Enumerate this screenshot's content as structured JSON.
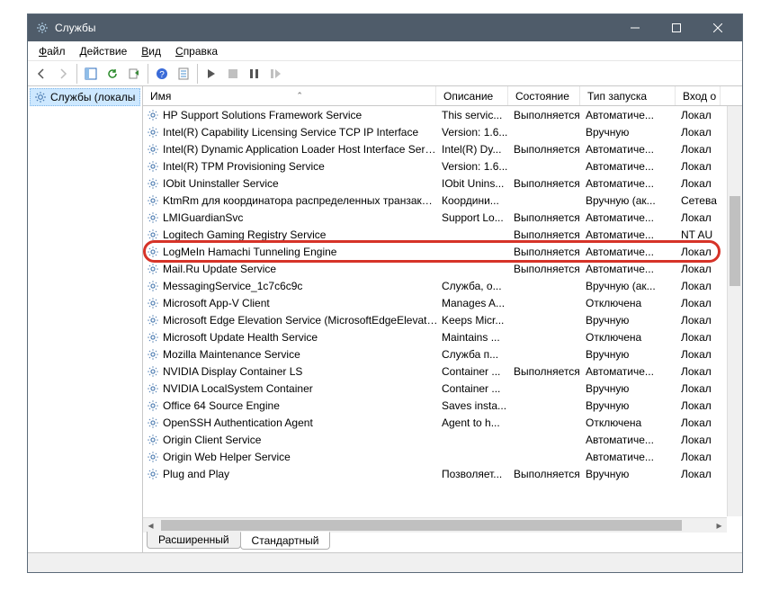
{
  "window": {
    "title": "Службы"
  },
  "menu": {
    "file": "Файл",
    "action": "Действие",
    "view": "Вид",
    "help": "Справка"
  },
  "left_pane": {
    "item": "Службы (локалы"
  },
  "columns": {
    "name": "Имя",
    "description": "Описание",
    "status": "Состояние",
    "startup": "Тип запуска",
    "logon": "Вход о"
  },
  "tabs": {
    "extended": "Расширенный",
    "standard": "Стандартный"
  },
  "services": [
    {
      "name": "HP Support Solutions Framework Service",
      "desc": "This servic...",
      "status": "Выполняется",
      "startup": "Автоматиче...",
      "logon": "Локал"
    },
    {
      "name": "Intel(R) Capability Licensing Service TCP IP Interface",
      "desc": "Version: 1.6...",
      "status": "",
      "startup": "Вручную",
      "logon": "Локал"
    },
    {
      "name": "Intel(R) Dynamic Application Loader Host Interface Service",
      "desc": "Intel(R) Dy...",
      "status": "Выполняется",
      "startup": "Автоматиче...",
      "logon": "Локал"
    },
    {
      "name": "Intel(R) TPM Provisioning Service",
      "desc": "Version: 1.6...",
      "status": "",
      "startup": "Автоматиче...",
      "logon": "Локал"
    },
    {
      "name": "IObit Uninstaller Service",
      "desc": "IObit Unins...",
      "status": "Выполняется",
      "startup": "Автоматиче...",
      "logon": "Локал"
    },
    {
      "name": "KtmRm для координатора распределенных транзакций",
      "desc": "Координи...",
      "status": "",
      "startup": "Вручную (ак...",
      "logon": "Сетева"
    },
    {
      "name": "LMIGuardianSvc",
      "desc": "Support Lo...",
      "status": "Выполняется",
      "startup": "Автоматиче...",
      "logon": "Локал"
    },
    {
      "name": "Logitech Gaming Registry Service",
      "desc": "",
      "status": "Выполняется",
      "startup": "Автоматиче...",
      "logon": "NT AU"
    },
    {
      "name": "LogMeIn Hamachi Tunneling Engine",
      "desc": "",
      "status": "Выполняется",
      "startup": "Автоматиче...",
      "logon": "Локал",
      "highlight": true
    },
    {
      "name": "Mail.Ru Update Service",
      "desc": "",
      "status": "Выполняется",
      "startup": "Автоматиче...",
      "logon": "Локал"
    },
    {
      "name": "MessagingService_1c7c6c9c",
      "desc": "Служба, о...",
      "status": "",
      "startup": "Вручную (ак...",
      "logon": "Локал"
    },
    {
      "name": "Microsoft App-V Client",
      "desc": "Manages A...",
      "status": "",
      "startup": "Отключена",
      "logon": "Локал"
    },
    {
      "name": "Microsoft Edge Elevation Service (MicrosoftEdgeElevatio...",
      "desc": "Keeps Micr...",
      "status": "",
      "startup": "Вручную",
      "logon": "Локал"
    },
    {
      "name": "Microsoft Update Health Service",
      "desc": "Maintains ...",
      "status": "",
      "startup": "Отключена",
      "logon": "Локал"
    },
    {
      "name": "Mozilla Maintenance Service",
      "desc": "Служба п...",
      "status": "",
      "startup": "Вручную",
      "logon": "Локал"
    },
    {
      "name": "NVIDIA Display Container LS",
      "desc": "Container ...",
      "status": "Выполняется",
      "startup": "Автоматиче...",
      "logon": "Локал"
    },
    {
      "name": "NVIDIA LocalSystem Container",
      "desc": "Container ...",
      "status": "",
      "startup": "Вручную",
      "logon": "Локал"
    },
    {
      "name": "Office 64 Source Engine",
      "desc": "Saves insta...",
      "status": "",
      "startup": "Вручную",
      "logon": "Локал"
    },
    {
      "name": "OpenSSH Authentication Agent",
      "desc": "Agent to h...",
      "status": "",
      "startup": "Отключена",
      "logon": "Локал"
    },
    {
      "name": "Origin Client Service",
      "desc": "",
      "status": "",
      "startup": "Автоматиче...",
      "logon": "Локал"
    },
    {
      "name": "Origin Web Helper Service",
      "desc": "",
      "status": "",
      "startup": "Автоматиче...",
      "logon": "Локал"
    },
    {
      "name": "Plug and Play",
      "desc": "Позволяет...",
      "status": "Выполняется",
      "startup": "Вручную",
      "logon": "Локал"
    }
  ]
}
